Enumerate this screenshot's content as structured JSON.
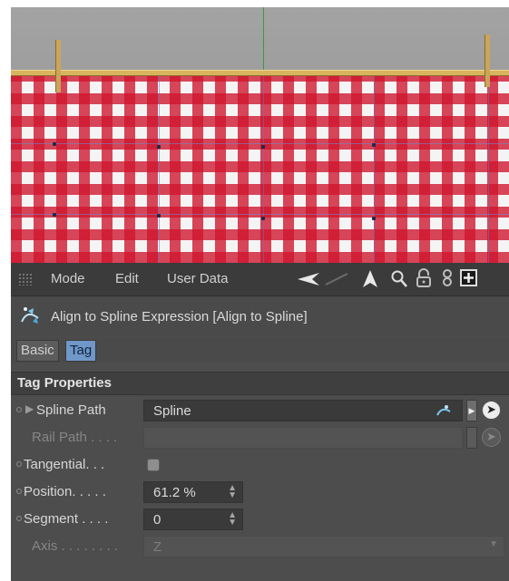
{
  "menubar": {
    "items": [
      "Mode",
      "Edit",
      "User Data"
    ],
    "icons": [
      "grip-icon",
      "back-arrow-icon",
      "forward-arrow-icon",
      "cursor-up-icon",
      "search-icon",
      "lock-icon",
      "link-icon",
      "new-window-icon"
    ]
  },
  "object": {
    "title": "Align to Spline Expression [Align to Spline]",
    "icon": "align-to-spline-icon"
  },
  "tabs": [
    {
      "label": "Basic",
      "active": false
    },
    {
      "label": "Tag",
      "active": true
    }
  ],
  "section": {
    "title": "Tag Properties"
  },
  "properties": {
    "spline_path": {
      "label": "Spline Path",
      "value": "Spline"
    },
    "rail_path": {
      "label": "Rail Path . . . .",
      "value": ""
    },
    "tangential": {
      "label": "Tangential. . .",
      "checked": false
    },
    "position": {
      "label": "Position. . . . .",
      "value": "61.2 %"
    },
    "segment": {
      "label": "Segment . . . .",
      "value": "0"
    },
    "axis": {
      "label": "Axis . . . . . . . .",
      "value": "Z"
    }
  },
  "colors": {
    "panel_bg": "#4d4d4d",
    "menubar_bg": "#3b3b3b",
    "active_tab": "#6f98c8",
    "cloth_red": "#ce142c"
  }
}
